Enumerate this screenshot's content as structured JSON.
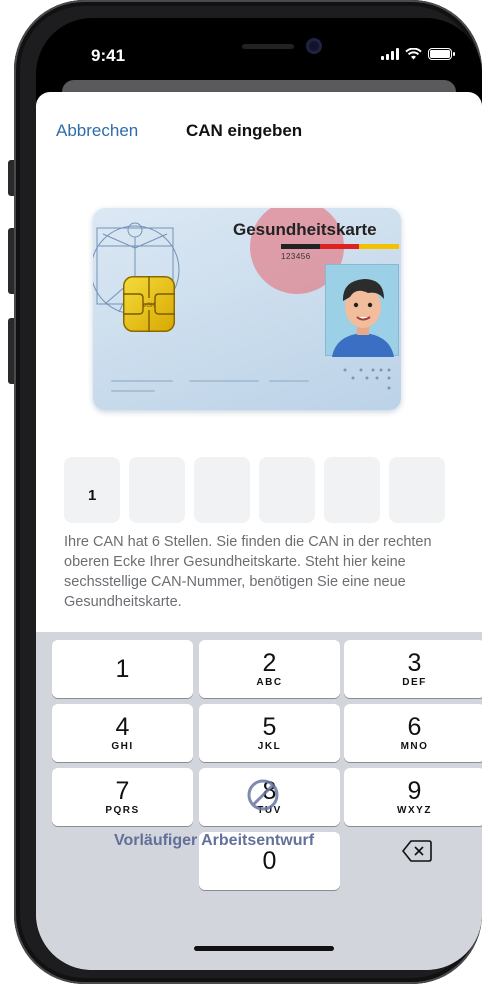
{
  "status_bar": {
    "time": "9:41",
    "icons": [
      "signal-icon",
      "wifi-icon",
      "battery-icon"
    ]
  },
  "nav": {
    "cancel_label": "Abbrechen",
    "title": "CAN eingeben"
  },
  "card": {
    "title": "Gesundheitskarte",
    "can_number": "123456"
  },
  "can_input": {
    "digits": [
      "1",
      "",
      "",
      "",
      "",
      ""
    ]
  },
  "hint_text": "Ihre CAN hat 6 Stellen. Sie finden die CAN in der rechten oberen Ecke Ihrer Gesundheitskarte. Steht hier keine sechsstellige CAN-Nummer, benötigen Sie eine neue Gesundheitskarte.",
  "keypad": {
    "keys": [
      {
        "num": "1",
        "letters": ""
      },
      {
        "num": "2",
        "letters": "ABC"
      },
      {
        "num": "3",
        "letters": "DEF"
      },
      {
        "num": "4",
        "letters": "GHI"
      },
      {
        "num": "5",
        "letters": "JKL"
      },
      {
        "num": "6",
        "letters": "MNO"
      },
      {
        "num": "7",
        "letters": "PQRS"
      },
      {
        "num": "8",
        "letters": "TUV"
      },
      {
        "num": "9",
        "letters": "WXYZ"
      },
      {
        "num": "0",
        "letters": ""
      }
    ]
  },
  "watermark": "Vorläufiger Arbeitsentwurf",
  "colors": {
    "accent": "#2f6da8",
    "keypad_bg": "#d2d5db",
    "can_box_bg": "#f1f2f4",
    "highlight": "#e8646e"
  }
}
